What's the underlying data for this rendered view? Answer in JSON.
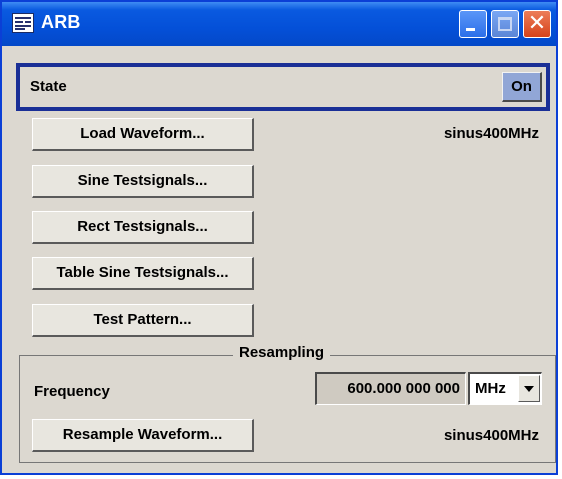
{
  "window": {
    "title": "ARB",
    "icon": "app-window-icon",
    "controls": {
      "minimize": "minimize-icon",
      "maximize": "maximize-icon",
      "close": "close-icon",
      "close_glyph": "✕"
    }
  },
  "state": {
    "label": "State",
    "value": "On",
    "accent": "#1a2f96",
    "toggle_color": "#91a6d6"
  },
  "buttons": {
    "load_waveform": "Load Waveform...",
    "sine_testsignals": "Sine Testsignals...",
    "rect_testsignals": "Rect Testsignals...",
    "table_sine_testsignals": "Table Sine Testsignals...",
    "test_pattern": "Test Pattern..."
  },
  "waveform_name": "sinus400MHz",
  "resampling": {
    "title": "Resampling",
    "frequency_label": "Frequency",
    "frequency_value": "600.000 000 000",
    "unit": "MHz",
    "resample_button": "Resample Waveform...",
    "resampled_name": "sinus400MHz"
  }
}
